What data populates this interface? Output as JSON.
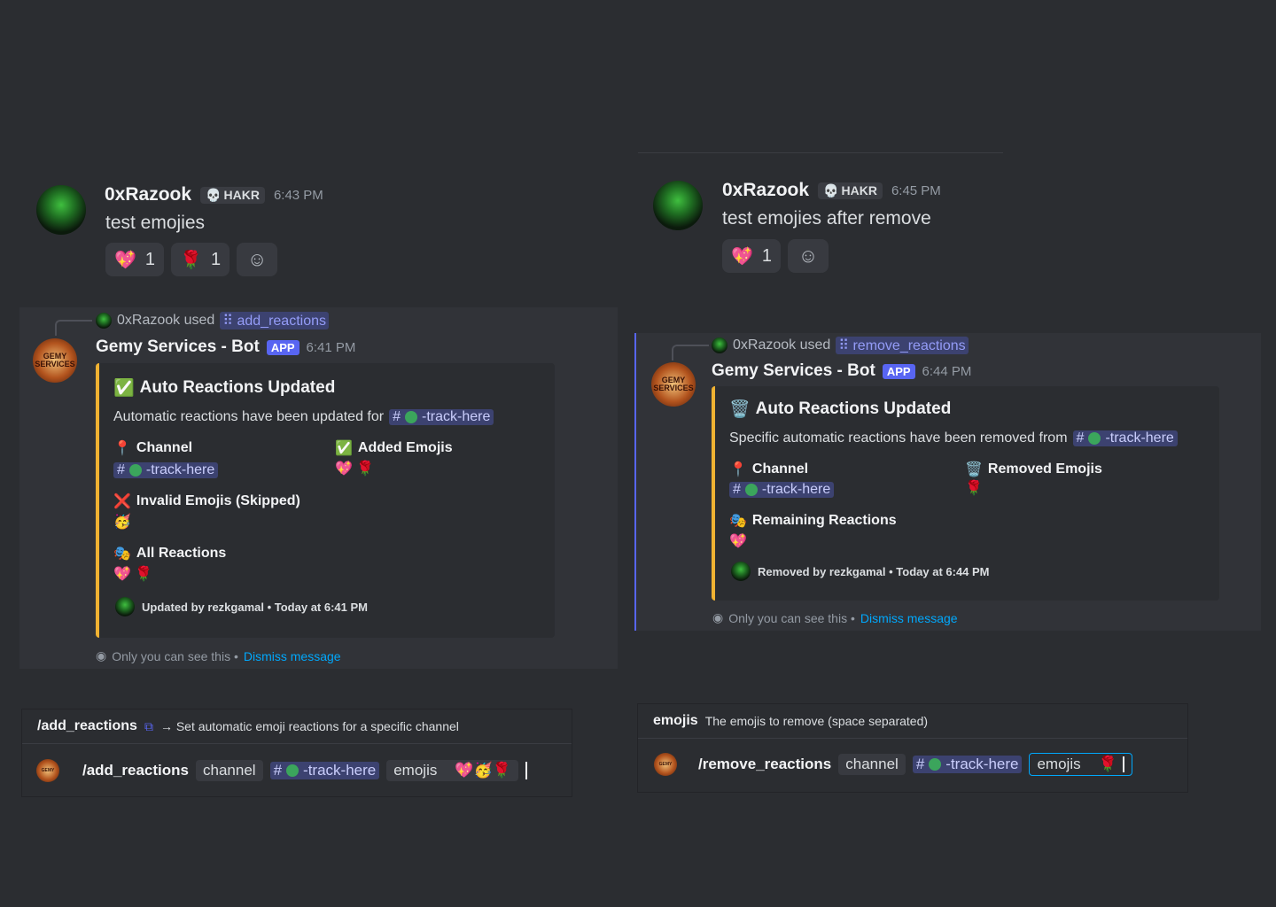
{
  "left": {
    "user_message": {
      "username": "0xRazook",
      "tag": "HAKR",
      "tag_icon": "skull-icon",
      "time": "6:43 PM",
      "text": "test emojies",
      "reactions": [
        {
          "emoji": "💖",
          "count": "1"
        },
        {
          "emoji": "🌹",
          "count": "1"
        }
      ]
    },
    "interaction": {
      "used_by": "0xRazook used",
      "command": "add_reactions",
      "bot_name": "Gemy Services - Bot",
      "app_badge": "APP",
      "time": "6:41 PM",
      "embed": {
        "title_emoji": "✅",
        "title": "Auto Reactions Updated",
        "description": "Automatic reactions have been updated for",
        "channel": "-track-here",
        "fields": [
          {
            "icon": "📍",
            "name": "Channel",
            "channel": "-track-here"
          },
          {
            "icon": "✅",
            "name": "Added Emojis",
            "value": "💖 🌹"
          },
          {
            "icon": "❌",
            "name": "Invalid Emojis (Skipped)",
            "value": "🥳"
          },
          {
            "icon": "🎭",
            "name": "All Reactions",
            "value": "💖 🌹"
          }
        ],
        "footer": "Updated by rezkgamal • Today at 6:41 PM"
      },
      "only_you": "Only you can see this •",
      "dismiss": "Dismiss message"
    },
    "command_box": {
      "name": "/add_reactions",
      "description": "→ Set automatic emoji reactions for a specific channel",
      "row_command": "/add_reactions",
      "opt_channel": "channel",
      "channel_value": "-track-here",
      "opt_emojis": "emojis",
      "emojis_value": "💖🥳🌹"
    }
  },
  "right": {
    "user_message": {
      "username": "0xRazook",
      "tag": "HAKR",
      "tag_icon": "skull-icon",
      "time": "6:45 PM",
      "text": "test emojies after remove",
      "reactions": [
        {
          "emoji": "💖",
          "count": "1"
        }
      ]
    },
    "interaction": {
      "used_by": "0xRazook used",
      "command": "remove_reactions",
      "bot_name": "Gemy Services - Bot",
      "app_badge": "APP",
      "time": "6:44 PM",
      "embed": {
        "title_emoji": "🗑️",
        "title": "Auto Reactions Updated",
        "description": "Specific automatic reactions have been removed from",
        "channel": "-track-here",
        "fields": [
          {
            "icon": "📍",
            "name": "Channel",
            "channel": "-track-here"
          },
          {
            "icon": "🗑️",
            "name": "Removed Emojis",
            "value": "🌹"
          },
          {
            "icon": "🎭",
            "name": "Remaining Reactions",
            "value": "💖"
          }
        ],
        "footer": "Removed by rezkgamal • Today at 6:44 PM"
      },
      "only_you": "Only you can see this •",
      "dismiss": "Dismiss message"
    },
    "command_box": {
      "option_name": "emojis",
      "option_desc": "The emojis to remove (space separated)",
      "row_command": "/remove_reactions",
      "opt_channel": "channel",
      "channel_value": "-track-here",
      "opt_emojis": "emojis",
      "emojis_value": "🌹"
    }
  }
}
